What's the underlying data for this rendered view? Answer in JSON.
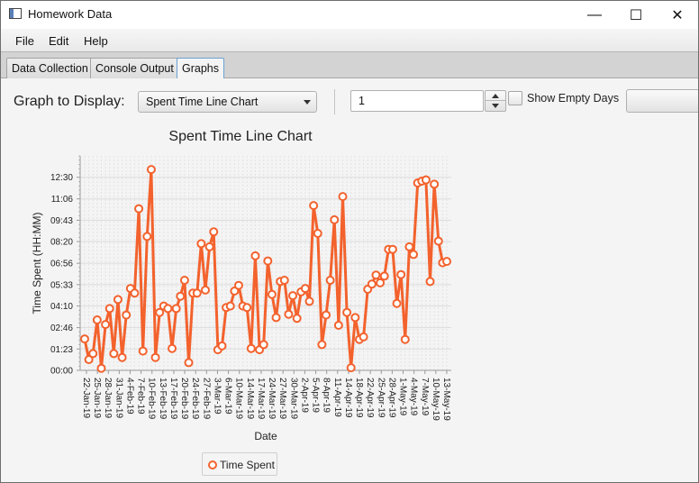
{
  "window": {
    "title": "Homework Data"
  },
  "window_controls": {
    "minimize": "—",
    "maximize": "☐",
    "close": "✕"
  },
  "menu": {
    "items": [
      "File",
      "Edit",
      "Help"
    ]
  },
  "tabs": [
    "Data Collection",
    "Console Output",
    "Graphs"
  ],
  "active_tab": "Graphs",
  "controls": {
    "graph_label": "Graph to Display:",
    "graph_selected": "Spent Time Line Chart",
    "spinner_value": "1",
    "checkbox_label": "Show Empty Days",
    "checkbox_checked": false
  },
  "colors": {
    "series": "#f3622d",
    "accent": "#6aa2d6"
  },
  "chart_data": {
    "type": "line",
    "title": "Spent Time Line Chart",
    "xlabel": "Date",
    "ylabel": "Time Spent (HH:MM)",
    "ytick_labels": [
      "00:00",
      "01:23",
      "02:46",
      "04:10",
      "05:33",
      "06:56",
      "08:20",
      "09:43",
      "11:06",
      "12:30"
    ],
    "ytick_minutes": [
      0,
      83,
      166,
      250,
      333,
      416,
      500,
      583,
      666,
      750
    ],
    "ylim_minutes": [
      0,
      833
    ],
    "xtick_labels": [
      "22-Jan-19",
      "25-Jan-19",
      "28-Jan-19",
      "31-Jan-19",
      "4-Feb-19",
      "7-Feb-19",
      "10-Feb-19",
      "13-Feb-19",
      "17-Feb-19",
      "20-Feb-19",
      "24-Feb-19",
      "27-Feb-19",
      "3-Mar-19",
      "6-Mar-19",
      "10-Mar-19",
      "14-Mar-19",
      "17-Mar-19",
      "24-Mar-19",
      "27-Mar-19",
      "30-Mar-19",
      "2-Apr-19",
      "5-Apr-19",
      "8-Apr-19",
      "11-Apr-19",
      "14-Apr-19",
      "18-Apr-19",
      "22-Apr-19",
      "25-Apr-19",
      "28-Apr-19",
      "1-May-19",
      "4-May-19",
      "7-May-19",
      "10-May-19",
      "13-May-19"
    ],
    "grid": true,
    "legend": "bottom",
    "series": [
      {
        "name": "Time Spent",
        "values_minutes": [
          122,
          42,
          65,
          196,
          8,
          178,
          240,
          65,
          275,
          50,
          215,
          318,
          300,
          628,
          75,
          520,
          780,
          50,
          225,
          250,
          240,
          85,
          240,
          288,
          350,
          30,
          300,
          300,
          492,
          312,
          480,
          538,
          80,
          95,
          244,
          250,
          308,
          330,
          250,
          244,
          85,
          445,
          80,
          100,
          425,
          295,
          205,
          345,
          350,
          218,
          290,
          202,
          305,
          318,
          268,
          640,
          532,
          100,
          215,
          350,
          585,
          175,
          675,
          225,
          10,
          205,
          120,
          130,
          315,
          335,
          370,
          340,
          366,
          470,
          470,
          260,
          372,
          120,
          480,
          450,
          728,
          735,
          740,
          345,
          723,
          502,
          418,
          423
        ]
      }
    ]
  }
}
